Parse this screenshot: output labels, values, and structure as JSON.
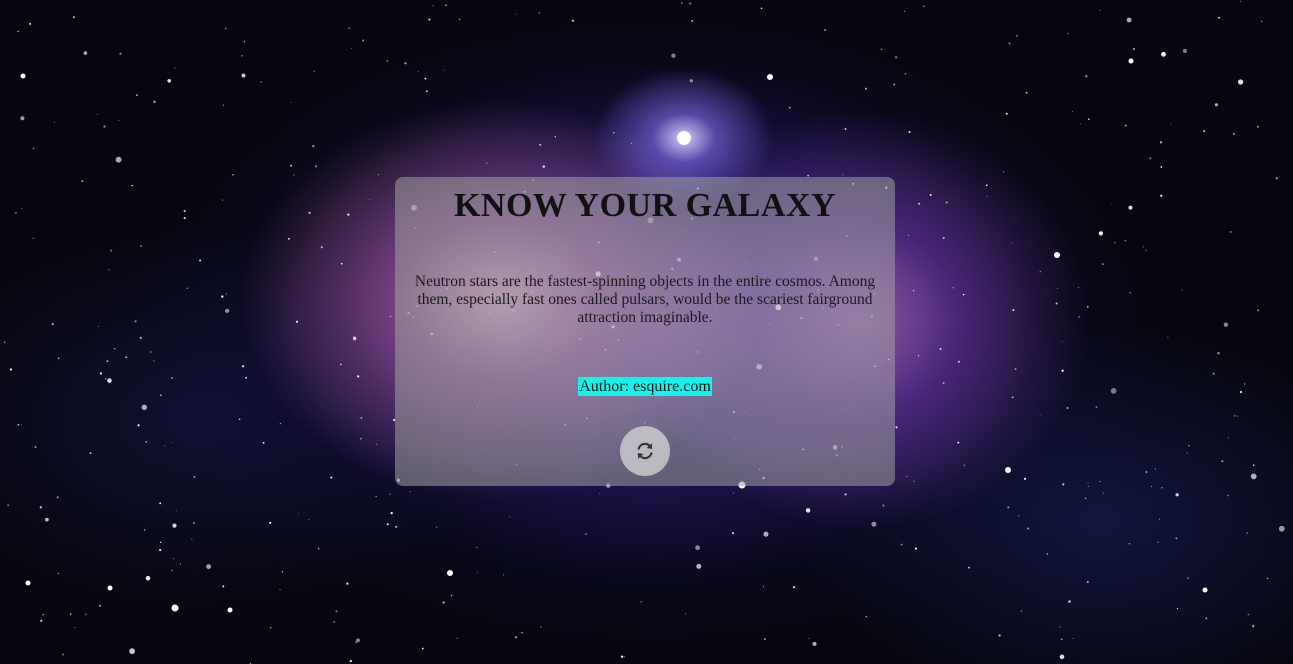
{
  "card": {
    "title": "KNOW YOUR GALAXY",
    "fact": "Neutron stars are the fastest-spinning objects in the entire cosmos. Among them, especially fast ones called pulsars, would be the scariest fairground attraction imaginable.",
    "author": "Author: esquire.com",
    "refresh_icon": "refresh-icon",
    "author_highlight_color": "#11f4ec"
  },
  "background": {
    "description_icon": "galaxy-background"
  }
}
